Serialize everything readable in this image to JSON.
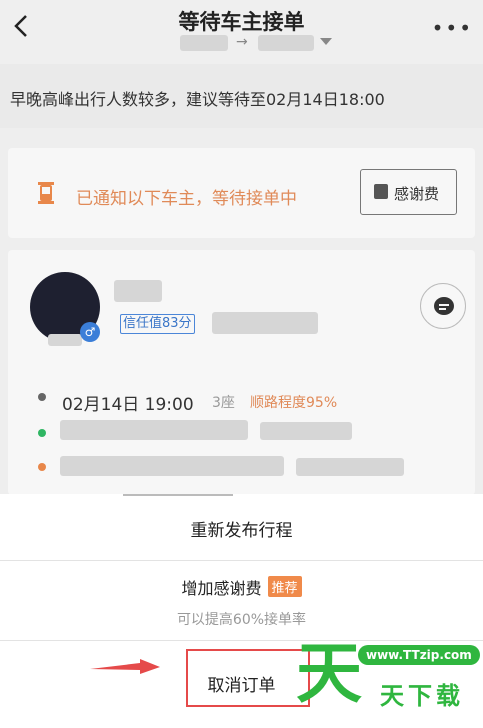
{
  "header": {
    "back_icon": "chevron-left-icon",
    "title": "等待车主接单",
    "more_icon": "more-dots-icon"
  },
  "notice": {
    "text": "早晚高峰出行人数较多，建议等待至02月14日18:00"
  },
  "status_card": {
    "icon": "hourglass-icon",
    "message": "已通知以下车主，等待接单中",
    "thanks_button_label": "感谢费"
  },
  "driver_card": {
    "trust_label": "信任值83分",
    "gender_symbol": "♂",
    "chat_icon": "chat-bubble-icon",
    "trip_time": "02月14日 19:00",
    "seats": "3座",
    "match_label": "顺路程度95%"
  },
  "sheet": {
    "republish_label": "重新发布行程",
    "add_thanks_label": "增加感谢费",
    "add_thanks_tag": "推荐",
    "add_thanks_sub": "可以提高60%接单率",
    "cancel_label": "取消订单"
  },
  "watermark": {
    "url": "www.TTzip.com",
    "big": "天",
    "text": "天下载"
  },
  "colors": {
    "accent_orange": "#e08a58",
    "trust_blue": "#3b76c8",
    "annotation_red": "#e54a4a",
    "watermark_green": "#2fb63f"
  }
}
